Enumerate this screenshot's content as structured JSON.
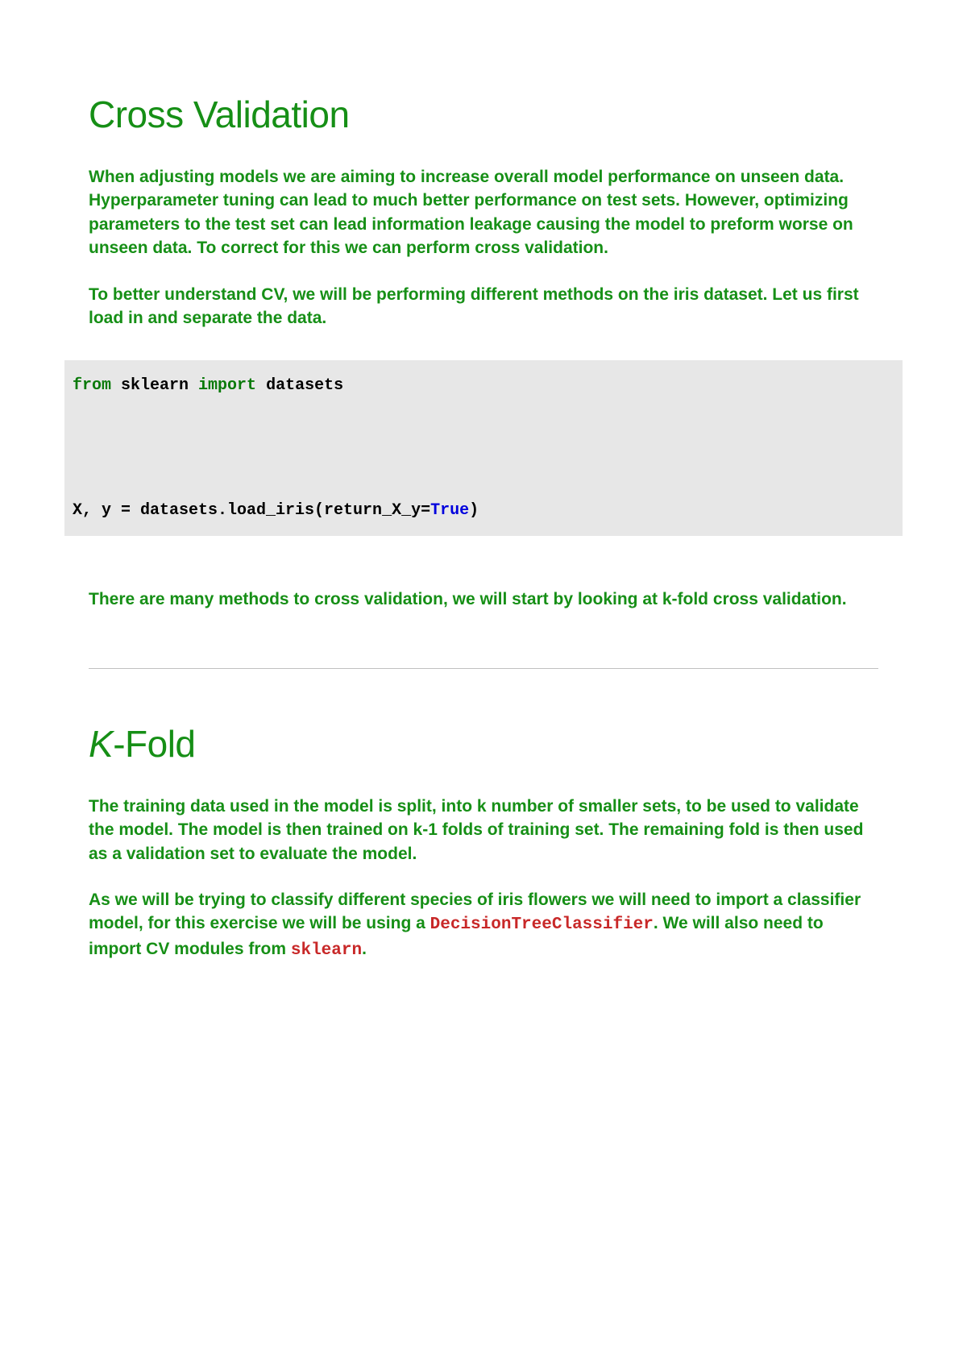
{
  "section1": {
    "title": "Cross Validation",
    "p1": "When adjusting models we are aiming to increase overall model performance on unseen data. Hyperparameter tuning can lead to much better performance on test sets. However, optimizing parameters to the test set can lead information leakage causing the model to preform worse on unseen data. To correct for this we can perform cross validation.",
    "p2": "To better understand CV, we will be performing different methods on the iris dataset. Let us first load in and separate the data.",
    "code1_part1": "from",
    "code1_part2": " sklearn ",
    "code1_part3": "import",
    "code1_part4": " datasets",
    "code1_blank": "\n\n\n\n\n",
    "code1_part5": "X, y = datasets.load_iris(return_X_y=",
    "code1_part6": "True",
    "code1_part7": ")",
    "p3": "There are many methods to cross validation, we will start by looking at k-fold cross validation."
  },
  "section2": {
    "title_italic": "K",
    "title_rest": "-Fold",
    "p1": "The training data used in the model is split, into k number of smaller sets, to be used to validate the model. The model is then trained on k-1 folds of training set. The remaining fold is then used as a validation set to evaluate the model.",
    "p2_pre": "As we will be trying to classify different species of iris flowers we will need to import a classifier model, for this exercise we will be using a ",
    "p2_code1": "DecisionTreeClassifier",
    "p2_mid": ". We will also need to import CV modules from ",
    "p2_code2": "sklearn",
    "p2_post": "."
  }
}
